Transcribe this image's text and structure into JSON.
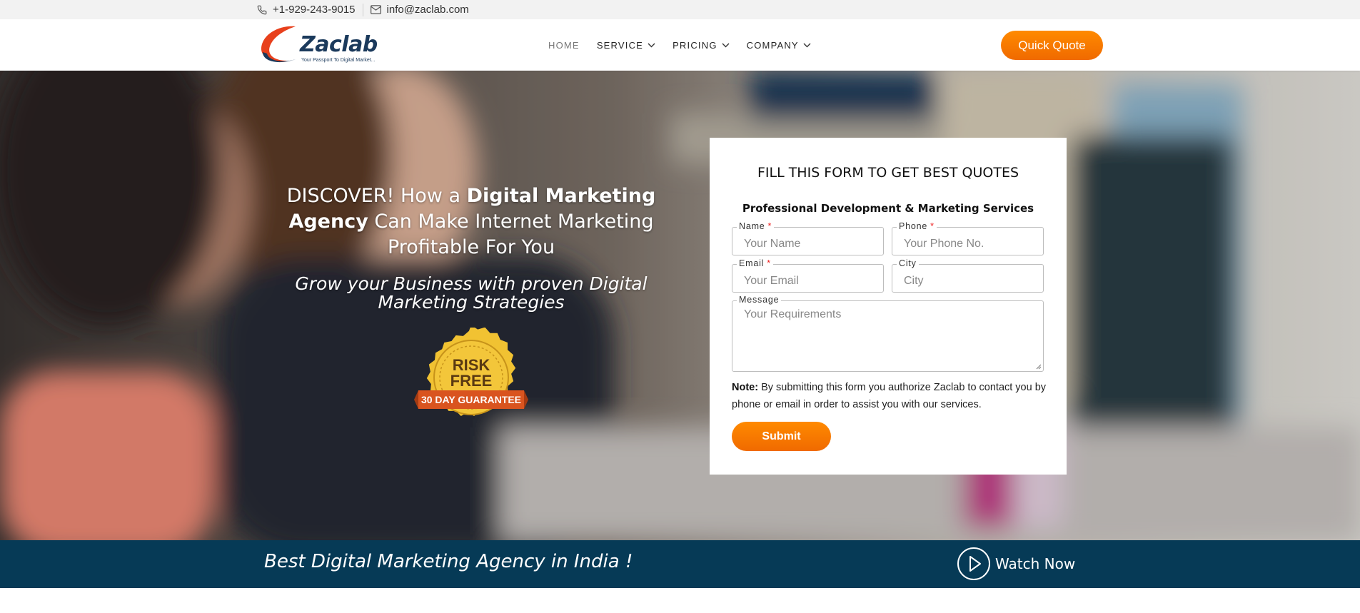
{
  "topbar": {
    "phone": "+1-929-243-9015",
    "email": "info@zaclab.com"
  },
  "header": {
    "logo_text": "Zaclab",
    "logo_tagline": "Your Passport To Digital Market...",
    "nav": [
      {
        "label": "HOME",
        "active": true,
        "has_dropdown": false
      },
      {
        "label": "SERVICE",
        "active": false,
        "has_dropdown": true
      },
      {
        "label": "PRICING",
        "active": false,
        "has_dropdown": true
      },
      {
        "label": "COMPANY",
        "active": false,
        "has_dropdown": true
      }
    ],
    "quote_button": "Quick Quote"
  },
  "hero": {
    "headline_1": "DISCOVER! How a ",
    "headline_bold_1": "Digital Marketing",
    "headline_bold_2": "Agency",
    "headline_2": " Can Make Internet Marketing",
    "headline_3": "Profitable For You",
    "subline": "Grow your Business with proven Digital Marketing Strategies",
    "badge_line1": "RISK",
    "badge_line2": "FREE",
    "badge_ribbon": "30 DAY GUARANTEE"
  },
  "form": {
    "title": "FILL THIS FORM TO GET BEST QUOTES",
    "subtitle": "Professional Development & Marketing Services",
    "name_label": "Name",
    "name_placeholder": "Your Name",
    "phone_label": "Phone",
    "phone_placeholder": "Your Phone No.",
    "email_label": "Email",
    "email_placeholder": "Your Email",
    "city_label": "City",
    "city_placeholder": "City",
    "message_label": "Message",
    "message_placeholder": "Your Requirements",
    "required_mark": "*",
    "note_label": "Note:",
    "note_text": " By submitting this form you authorize Zaclab to contact you by phone or email in order to assist you with our services.",
    "submit": "Submit"
  },
  "bottom_bar": {
    "tagline": "Best Digital Marketing Agency in India !",
    "watch_label": "Watch Now"
  },
  "colors": {
    "accent_orange": "#f57c00",
    "navy": "#063a56",
    "topbar_bg": "#f2f2f2"
  }
}
